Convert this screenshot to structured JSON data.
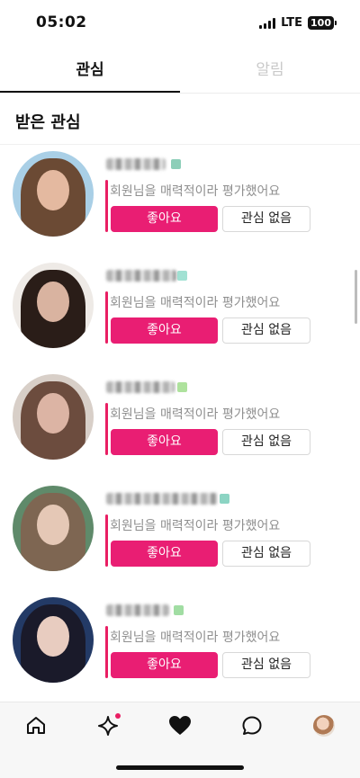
{
  "status_bar": {
    "time": "05:02",
    "network": "LTE",
    "battery": "100"
  },
  "tabs": [
    {
      "label": "관심",
      "active": true
    },
    {
      "label": "알림",
      "active": false
    }
  ],
  "section_title": "받은 관심",
  "cards": [
    {
      "message": "회원님을 매력적이라 평가했어요",
      "like_label": "좋아요",
      "pass_label": "관심 없음",
      "avatar_colors": {
        "bg": "#a9cfe6",
        "hair": "#6b4a34",
        "face": "#e4b9a0"
      },
      "verify_color": "#6fc2a6"
    },
    {
      "message": "회원님을 매력적이라 평가했어요",
      "like_label": "좋아요",
      "pass_label": "관심 없음",
      "avatar_colors": {
        "bg": "#eeeae6",
        "hair": "#2a1d18",
        "face": "#d9b3a0"
      },
      "verify_color": "#8ad9c8"
    },
    {
      "message": "회원님을 매력적이라 평가했어요",
      "like_label": "좋아요",
      "pass_label": "관심 없음",
      "avatar_colors": {
        "bg": "#d8cfc8",
        "hair": "#6c4c3e",
        "face": "#dcb4a4"
      },
      "verify_color": "#9adb84"
    },
    {
      "message": "회원님을 매력적이라 평가했어요",
      "like_label": "좋아요",
      "pass_label": "관심 없음",
      "avatar_colors": {
        "bg": "#5f8a6a",
        "hair": "#7e6652",
        "face": "#e5c8b6"
      },
      "verify_color": "#6fc9b4"
    },
    {
      "message": "회원님을 매력적이라 평가했어요",
      "like_label": "좋아요",
      "pass_label": "관심 없음",
      "avatar_colors": {
        "bg": "#233a66",
        "hair": "#1a1a2a",
        "face": "#e8ccc0"
      },
      "verify_color": "#8ad48c"
    }
  ],
  "bottom_nav": [
    {
      "icon": "home-icon"
    },
    {
      "icon": "sparkle-icon",
      "has_badge": true
    },
    {
      "icon": "heart-icon"
    },
    {
      "icon": "chat-icon"
    },
    {
      "icon": "profile-avatar-icon"
    }
  ],
  "colors": {
    "accent": "#e91e73",
    "text_primary": "#111111",
    "text_muted": "#8f8f8f",
    "tab_inactive": "#c9c9c9"
  }
}
